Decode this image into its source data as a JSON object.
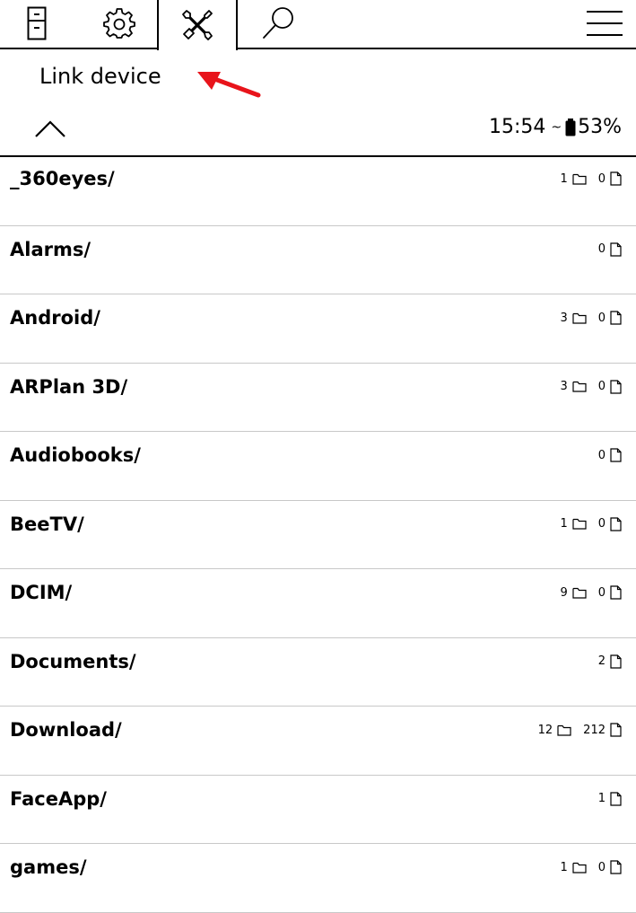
{
  "topbar": {
    "tabs": [
      {
        "icon": "file-manager-icon"
      },
      {
        "icon": "gear-icon"
      },
      {
        "icon": "tools-icon",
        "active": true
      },
      {
        "icon": "search-icon"
      }
    ],
    "menu_icon": "hamburger-menu-icon"
  },
  "menu": {
    "item_label": "Link device"
  },
  "annotation": {
    "color": "#e8141b"
  },
  "status": {
    "time": "15:54",
    "separator": "~",
    "battery": "53%"
  },
  "files": [
    {
      "name": "_360eyes/",
      "folders": "1",
      "files": "0"
    },
    {
      "name": "Alarms/",
      "folders": null,
      "files": "0"
    },
    {
      "name": "Android/",
      "folders": "3",
      "files": "0"
    },
    {
      "name": "ARPlan 3D/",
      "folders": "3",
      "files": "0"
    },
    {
      "name": "Audiobooks/",
      "folders": null,
      "files": "0"
    },
    {
      "name": "BeeTV/",
      "folders": "1",
      "files": "0"
    },
    {
      "name": "DCIM/",
      "folders": "9",
      "files": "0"
    },
    {
      "name": "Documents/",
      "folders": null,
      "files": "2"
    },
    {
      "name": "Download/",
      "folders": "12",
      "files": "212"
    },
    {
      "name": "FaceApp/",
      "folders": null,
      "files": "1"
    },
    {
      "name": "games/",
      "folders": "1",
      "files": "0"
    }
  ]
}
